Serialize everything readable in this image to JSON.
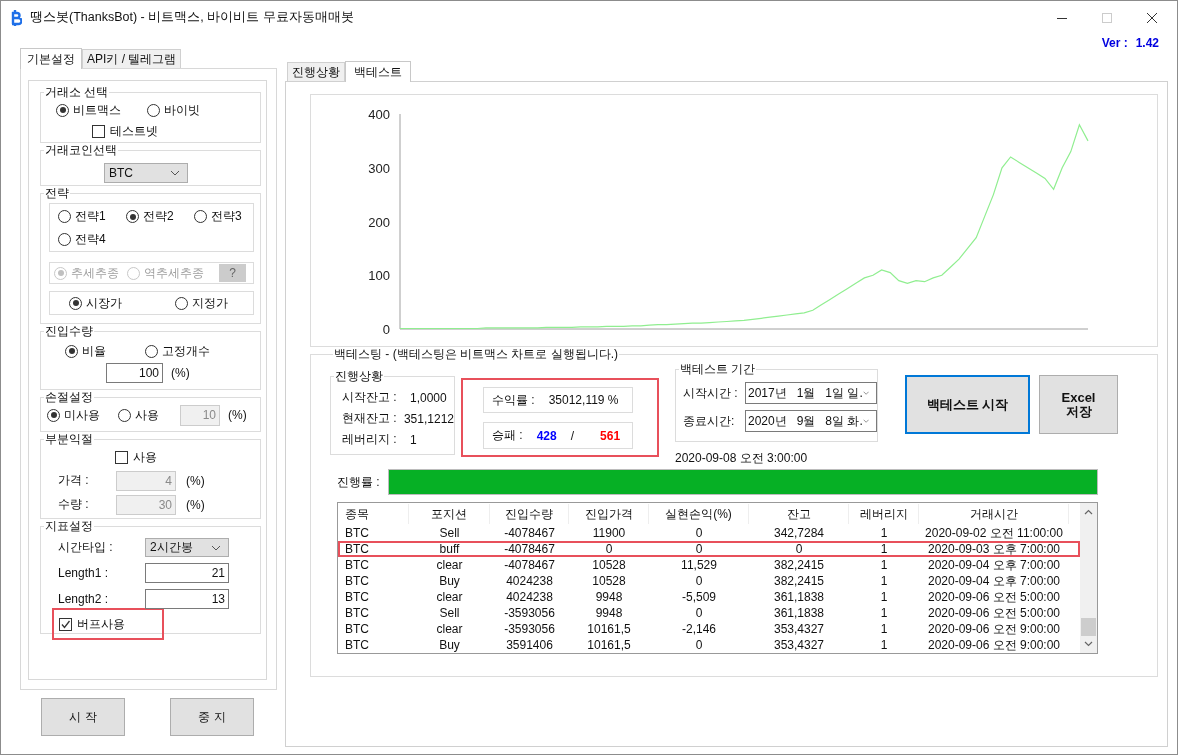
{
  "window": {
    "title": "땡스봇(ThanksBot) - 비트맥스, 바이비트 무료자동매매봇"
  },
  "version": {
    "label": "Ver :",
    "value": "1.42"
  },
  "left_tabs": [
    {
      "label": "기본설정",
      "selected": true
    },
    {
      "label": "API키 / 텔레그램",
      "selected": false
    }
  ],
  "exchange": {
    "title": "거래소 선택",
    "options": [
      {
        "label": "비트맥스",
        "selected": true
      },
      {
        "label": "바이빗",
        "selected": false
      }
    ],
    "testnet": {
      "label": "테스트넷",
      "checked": false
    }
  },
  "coin": {
    "title": "거래코인선택",
    "value": "BTC"
  },
  "strategy": {
    "title": "전략",
    "options": [
      {
        "label": "전략1",
        "selected": false
      },
      {
        "label": "전략2",
        "selected": true
      },
      {
        "label": "전략3",
        "selected": false
      },
      {
        "label": "전략4",
        "selected": false
      }
    ],
    "trend": {
      "disabled": true,
      "options": [
        {
          "label": "추세추종",
          "selected": true
        },
        {
          "label": "역추세추종",
          "selected": false
        }
      ],
      "help": "?"
    },
    "order_type": [
      {
        "label": "시장가",
        "selected": true
      },
      {
        "label": "지정가",
        "selected": false
      }
    ]
  },
  "entry": {
    "title": "진입수량",
    "options": [
      {
        "label": "비율",
        "selected": true
      },
      {
        "label": "고정개수",
        "selected": false
      }
    ],
    "value": "100",
    "unit": "(%)"
  },
  "stop_loss": {
    "title": "손절설정",
    "options": [
      {
        "label": "미사용",
        "selected": true
      },
      {
        "label": "사용",
        "selected": false
      }
    ],
    "value": "10",
    "unit": "(%)",
    "disabled": true
  },
  "partial": {
    "title": "부분익절",
    "use": {
      "label": "사용",
      "checked": false
    },
    "disabled": true,
    "fields": [
      {
        "label": "가격 :",
        "value": "4",
        "unit": "(%)"
      },
      {
        "label": "수량 :",
        "value": "30",
        "unit": "(%)"
      }
    ]
  },
  "indicator": {
    "title": "지표설정",
    "time_type": {
      "label": "시간타입 :",
      "value": "2시간봉"
    },
    "fields": [
      {
        "label": "Length1 :",
        "value": "21"
      },
      {
        "label": "Length2 :",
        "value": "13"
      }
    ],
    "buff": {
      "label": "버프사용",
      "checked": true,
      "highlighted": true
    }
  },
  "buttons": [
    {
      "label": "시 작"
    },
    {
      "label": "중 지"
    }
  ],
  "right_tabs": [
    {
      "label": "진행상황",
      "selected": false
    },
    {
      "label": "백테스트",
      "selected": true
    }
  ],
  "chart_data": {
    "type": "line",
    "ylim": [
      0,
      400
    ],
    "yticks": [
      0,
      100,
      200,
      300,
      400
    ],
    "series": [
      {
        "color": "#90ee90",
        "values": [
          1,
          1,
          1,
          1,
          1,
          1,
          1,
          1,
          1,
          1,
          2,
          2,
          2,
          2,
          2,
          2,
          2,
          3,
          3,
          3,
          3,
          4,
          4,
          4,
          5,
          5,
          5,
          6,
          6,
          7,
          8,
          8,
          9,
          10,
          11,
          11,
          12,
          13,
          14,
          15,
          16,
          18,
          20,
          22,
          24,
          26,
          28,
          30,
          35,
          45,
          55,
          65,
          75,
          85,
          95,
          100,
          110,
          105,
          90,
          85,
          90,
          88,
          95,
          100,
          115,
          130,
          150,
          170,
          210,
          250,
          300,
          320,
          310,
          300,
          290,
          280,
          260,
          300,
          330,
          380,
          350
        ]
      }
    ]
  },
  "backtest": {
    "title": "백테스팅 - (백테스팅은 비트맥스 차트로 실행됩니다.)",
    "status": {
      "title": "진행상황",
      "rows": [
        {
          "label": "시작잔고 :",
          "value": "1,0000"
        },
        {
          "label": "현재잔고 :",
          "value": "351,1212"
        },
        {
          "label": "레버리지 :",
          "value": "1"
        }
      ]
    },
    "results": {
      "highlighted": true,
      "return": {
        "label": "수익률 :",
        "value": "35012,119 %"
      },
      "record": {
        "label": "승패 :",
        "wins": "428",
        "separator": "/",
        "losses": "561"
      }
    },
    "period": {
      "title": "백테스트 기간",
      "rows": [
        {
          "label": "시작시간 :",
          "value": "2017년   1월   1일 일."
        },
        {
          "label": "종료시간:",
          "value": "2020년   9월   8일 화."
        }
      ]
    },
    "start_button": "백테스트 시작",
    "excel_button": "Excel 저장",
    "timestamp": "2020-09-08 오전 3:00:00",
    "progress": {
      "label": "진행률 :",
      "level": 1
    },
    "table": {
      "columns": [
        "종목",
        "포지션",
        "진입수량",
        "진입가격",
        "실현손익(%)",
        "잔고",
        "레버리지",
        "거래시간"
      ],
      "rows": [
        {
          "cells": [
            "BTC",
            "Sell",
            "-4078467",
            "11900",
            "0",
            "342,7284",
            "1",
            "2020-09-02 오전 11:00:00"
          ],
          "highlighted": false
        },
        {
          "cells": [
            "BTC",
            "buff",
            "-4078467",
            "0",
            "0",
            "0",
            "1",
            "2020-09-03 오후 7:00:00"
          ],
          "highlighted": true
        },
        {
          "cells": [
            "BTC",
            "clear",
            "-4078467",
            "10528",
            "11,529",
            "382,2415",
            "1",
            "2020-09-04 오후 7:00:00"
          ],
          "highlighted": false
        },
        {
          "cells": [
            "BTC",
            "Buy",
            "4024238",
            "10528",
            "0",
            "382,2415",
            "1",
            "2020-09-04 오후 7:00:00"
          ],
          "highlighted": false
        },
        {
          "cells": [
            "BTC",
            "clear",
            "4024238",
            "9948",
            "-5,509",
            "361,1838",
            "1",
            "2020-09-06 오전 5:00:00"
          ],
          "highlighted": false
        },
        {
          "cells": [
            "BTC",
            "Sell",
            "-3593056",
            "9948",
            "0",
            "361,1838",
            "1",
            "2020-09-06 오전 5:00:00"
          ],
          "highlighted": false
        },
        {
          "cells": [
            "BTC",
            "clear",
            "-3593056",
            "10161,5",
            "-2,146",
            "353,4327",
            "1",
            "2020-09-06 오전 9:00:00"
          ],
          "highlighted": false
        },
        {
          "cells": [
            "BTC",
            "Buy",
            "3591406",
            "10161,5",
            "0",
            "353,4327",
            "1",
            "2020-09-06 오전 9:00:00"
          ],
          "highlighted": false
        }
      ]
    }
  }
}
